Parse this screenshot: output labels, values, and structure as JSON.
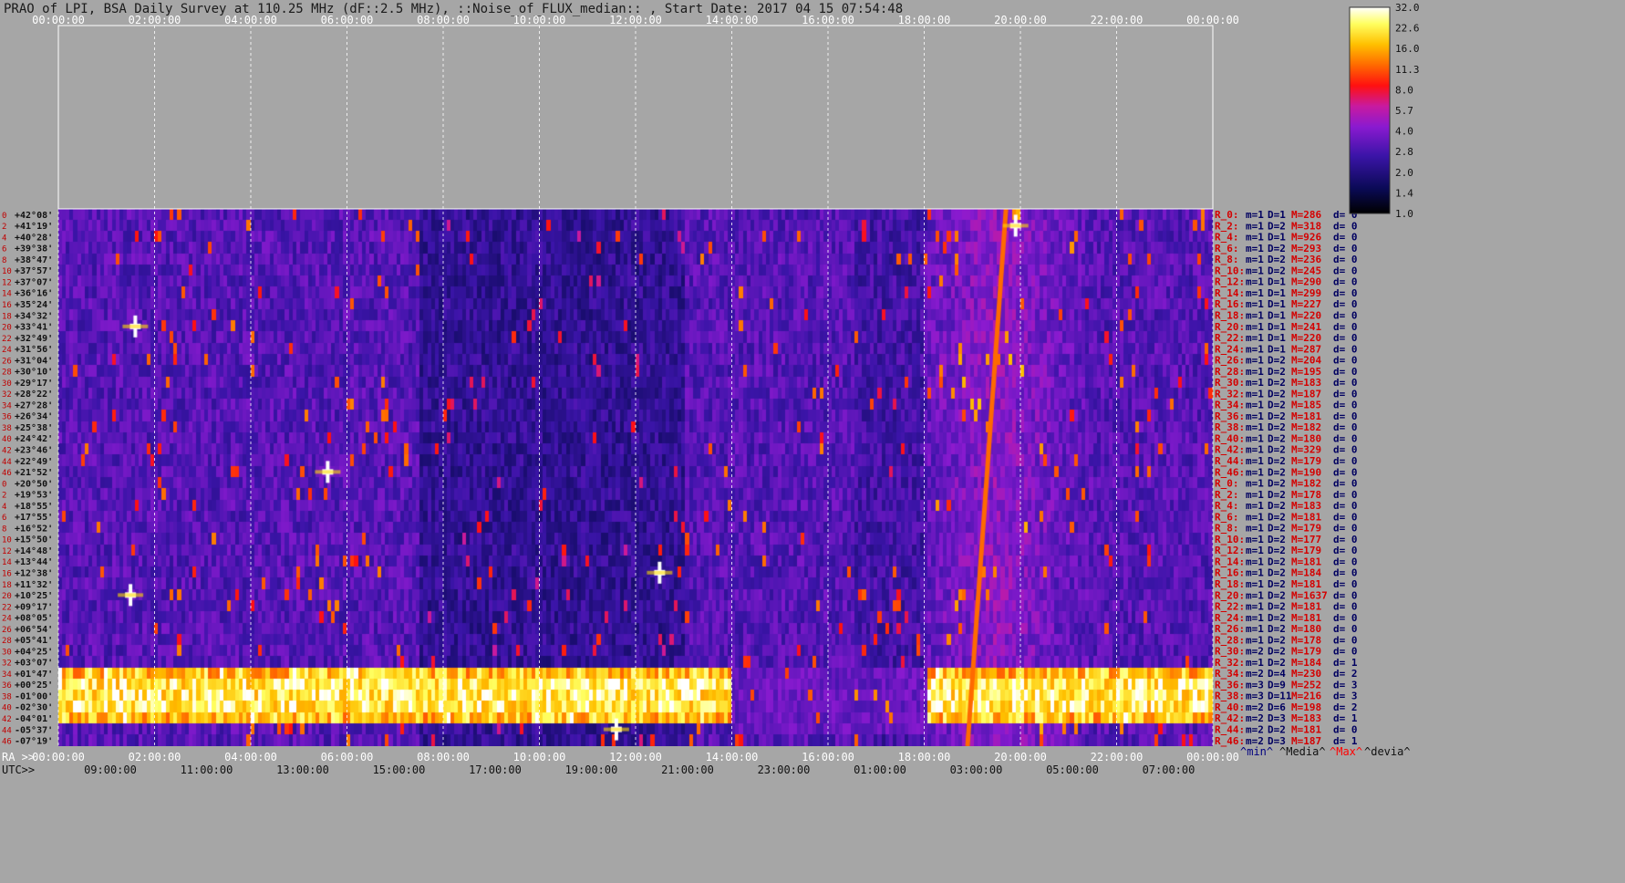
{
  "title": "PRAO of LPI, BSA Daily Survey at 110.25 MHz (dF::2.5 MHz), ::Noise_of_FLUX_median:: , Start Date: 2017 04 15 07:54:48",
  "colors": {
    "background": "#a6a6a6",
    "beam_label_red": "#d40000",
    "beam_value_navy": "#000060",
    "legend_min": "#000080",
    "legend_max": "#ff0000"
  },
  "chart_data": {
    "type": "heatmap",
    "top_time_axis": {
      "labels": [
        "00:00:00",
        "02:00:00",
        "04:00:00",
        "06:00:00",
        "08:00:00",
        "10:00:00",
        "12:00:00",
        "14:00:00",
        "16:00:00",
        "18:00:00",
        "20:00:00",
        "22:00:00",
        "00:00:00"
      ],
      "range_hours": [
        0,
        24
      ]
    },
    "bottom_ra_axis": {
      "prefix": "RA >>",
      "labels": [
        "00:00:00",
        "02:00:00",
        "04:00:00",
        "06:00:00",
        "08:00:00",
        "10:00:00",
        "12:00:00",
        "14:00:00",
        "16:00:00",
        "18:00:00",
        "20:00:00",
        "22:00:00",
        "00:00:00"
      ]
    },
    "bottom_utc_axis": {
      "prefix": "UTC>>",
      "labels": [
        "09:00:00",
        "11:00:00",
        "13:00:00",
        "15:00:00",
        "17:00:00",
        "19:00:00",
        "21:00:00",
        "23:00:00",
        "01:00:00",
        "03:00:00",
        "05:00:00",
        "07:00:00"
      ]
    },
    "colorbar": {
      "ticks": [
        "32.0",
        "22.6",
        "16.0",
        "11.3",
        "8.0",
        "5.7",
        "4.0",
        "2.8",
        "2.0",
        "1.4",
        "1.0"
      ],
      "scale": "log2",
      "range": [
        1.0,
        32.0
      ],
      "colormap": "black-blue-purple-red-orange-yellow-white"
    },
    "row_indices": [
      "0",
      "2",
      "4",
      "6",
      "8",
      "10",
      "12",
      "14",
      "16",
      "18",
      "20",
      "22",
      "24",
      "26",
      "28",
      "30",
      "32",
      "34",
      "36",
      "38",
      "40",
      "42",
      "44",
      "46",
      "0",
      "2",
      "4",
      "6",
      "8",
      "10",
      "12",
      "14",
      "16",
      "18",
      "20",
      "22",
      "24",
      "26",
      "28",
      "30",
      "32",
      "34",
      "36",
      "38",
      "40",
      "42",
      "44",
      "46"
    ],
    "declinations": [
      "+42°08'",
      "+41°19'",
      "+40°28'",
      "+39°38'",
      "+38°47'",
      "+37°57'",
      "+37°07'",
      "+36°16'",
      "+35°24'",
      "+34°32'",
      "+33°41'",
      "+32°49'",
      "+31°56'",
      "+31°04'",
      "+30°10'",
      "+29°17'",
      "+28°22'",
      "+27°28'",
      "+26°34'",
      "+25°38'",
      "+24°42'",
      "+23°46'",
      "+22°49'",
      "+21°52'",
      "+20°50'",
      "+19°53'",
      "+18°55'",
      "+17°55'",
      "+16°52'",
      "+15°50'",
      "+14°48'",
      "+13°44'",
      "+12°38'",
      "+11°32'",
      "+10°25'",
      "+09°17'",
      "+08°05'",
      "+06°54'",
      "+05°41'",
      "+04°25'",
      "+03°07'",
      "+01°47'",
      "+00°25'",
      "-01°00'",
      "-02°30'",
      "-04°01'",
      "-05°37'",
      "-07°19'"
    ],
    "beams": [
      {
        "beam": "R_0:",
        "m": "m=1",
        "D": "D=1",
        "M": "M=286",
        "d": "d= 0"
      },
      {
        "beam": "R_2:",
        "m": "m=1",
        "D": "D=2",
        "M": "M=318",
        "d": "d= 0"
      },
      {
        "beam": "R_4:",
        "m": "m=1",
        "D": "D=1",
        "M": "M=926",
        "d": "d= 0"
      },
      {
        "beam": "R_6:",
        "m": "m=1",
        "D": "D=2",
        "M": "M=293",
        "d": "d= 0"
      },
      {
        "beam": "R_8:",
        "m": "m=1",
        "D": "D=2",
        "M": "M=236",
        "d": "d= 0"
      },
      {
        "beam": "R_10:",
        "m": "m=1",
        "D": "D=2",
        "M": "M=245",
        "d": "d= 0"
      },
      {
        "beam": "R_12:",
        "m": "m=1",
        "D": "D=1",
        "M": "M=290",
        "d": "d= 0"
      },
      {
        "beam": "R_14:",
        "m": "m=1",
        "D": "D=1",
        "M": "M=299",
        "d": "d= 0"
      },
      {
        "beam": "R_16:",
        "m": "m=1",
        "D": "D=1",
        "M": "M=227",
        "d": "d= 0"
      },
      {
        "beam": "R_18:",
        "m": "m=1",
        "D": "D=1",
        "M": "M=220",
        "d": "d= 0"
      },
      {
        "beam": "R_20:",
        "m": "m=1",
        "D": "D=1",
        "M": "M=241",
        "d": "d= 0"
      },
      {
        "beam": "R_22:",
        "m": "m=1",
        "D": "D=1",
        "M": "M=220",
        "d": "d= 0"
      },
      {
        "beam": "R_24:",
        "m": "m=1",
        "D": "D=1",
        "M": "M=287",
        "d": "d= 0"
      },
      {
        "beam": "R_26:",
        "m": "m=1",
        "D": "D=2",
        "M": "M=204",
        "d": "d= 0"
      },
      {
        "beam": "R_28:",
        "m": "m=1",
        "D": "D=2",
        "M": "M=195",
        "d": "d= 0"
      },
      {
        "beam": "R_30:",
        "m": "m=1",
        "D": "D=2",
        "M": "M=183",
        "d": "d= 0"
      },
      {
        "beam": "R_32:",
        "m": "m=1",
        "D": "D=2",
        "M": "M=187",
        "d": "d= 0"
      },
      {
        "beam": "R_34:",
        "m": "m=1",
        "D": "D=2",
        "M": "M=185",
        "d": "d= 0"
      },
      {
        "beam": "R_36:",
        "m": "m=1",
        "D": "D=2",
        "M": "M=181",
        "d": "d= 0"
      },
      {
        "beam": "R_38:",
        "m": "m=1",
        "D": "D=2",
        "M": "M=182",
        "d": "d= 0"
      },
      {
        "beam": "R_40:",
        "m": "m=1",
        "D": "D=2",
        "M": "M=180",
        "d": "d= 0"
      },
      {
        "beam": "R_42:",
        "m": "m=1",
        "D": "D=2",
        "M": "M=329",
        "d": "d= 0"
      },
      {
        "beam": "R_44:",
        "m": "m=1",
        "D": "D=2",
        "M": "M=179",
        "d": "d= 0"
      },
      {
        "beam": "R_46:",
        "m": "m=1",
        "D": "D=2",
        "M": "M=190",
        "d": "d= 0"
      },
      {
        "beam": "R_0:",
        "m": "m=1",
        "D": "D=2",
        "M": "M=182",
        "d": "d= 0"
      },
      {
        "beam": "R_2:",
        "m": "m=1",
        "D": "D=2",
        "M": "M=178",
        "d": "d= 0"
      },
      {
        "beam": "R_4:",
        "m": "m=1",
        "D": "D=2",
        "M": "M=183",
        "d": "d= 0"
      },
      {
        "beam": "R_6:",
        "m": "m=1",
        "D": "D=2",
        "M": "M=181",
        "d": "d= 0"
      },
      {
        "beam": "R_8:",
        "m": "m=1",
        "D": "D=2",
        "M": "M=179",
        "d": "d= 0"
      },
      {
        "beam": "R_10:",
        "m": "m=1",
        "D": "D=2",
        "M": "M=177",
        "d": "d= 0"
      },
      {
        "beam": "R_12:",
        "m": "m=1",
        "D": "D=2",
        "M": "M=179",
        "d": "d= 0"
      },
      {
        "beam": "R_14:",
        "m": "m=1",
        "D": "D=2",
        "M": "M=181",
        "d": "d= 0"
      },
      {
        "beam": "R_16:",
        "m": "m=1",
        "D": "D=2",
        "M": "M=184",
        "d": "d= 0"
      },
      {
        "beam": "R_18:",
        "m": "m=1",
        "D": "D=2",
        "M": "M=181",
        "d": "d= 0"
      },
      {
        "beam": "R_20:",
        "m": "m=1",
        "D": "D=2",
        "M": "M=1637",
        "d": "d= 0"
      },
      {
        "beam": "R_22:",
        "m": "m=1",
        "D": "D=2",
        "M": "M=181",
        "d": "d= 0"
      },
      {
        "beam": "R_24:",
        "m": "m=1",
        "D": "D=2",
        "M": "M=181",
        "d": "d= 0"
      },
      {
        "beam": "R_26:",
        "m": "m=1",
        "D": "D=2",
        "M": "M=180",
        "d": "d= 0"
      },
      {
        "beam": "R_28:",
        "m": "m=1",
        "D": "D=2",
        "M": "M=178",
        "d": "d= 0"
      },
      {
        "beam": "R_30:",
        "m": "m=2",
        "D": "D=2",
        "M": "M=179",
        "d": "d= 0"
      },
      {
        "beam": "R_32:",
        "m": "m=1",
        "D": "D=2",
        "M": "M=184",
        "d": "d= 1"
      },
      {
        "beam": "R_34:",
        "m": "m=2",
        "D": "D=4",
        "M": "M=230",
        "d": "d= 2"
      },
      {
        "beam": "R_36:",
        "m": "m=3",
        "D": "D=9",
        "M": "M=252",
        "d": "d= 3"
      },
      {
        "beam": "R_38:",
        "m": "m=3",
        "D": "D=11",
        "M": "M=216",
        "d": "d= 3"
      },
      {
        "beam": "R_40:",
        "m": "m=2",
        "D": "D=6",
        "M": "M=198",
        "d": "d= 2"
      },
      {
        "beam": "R_42:",
        "m": "m=2",
        "D": "D=3",
        "M": "M=183",
        "d": "d= 1"
      },
      {
        "beam": "R_44:",
        "m": "m=2",
        "D": "D=2",
        "M": "M=181",
        "d": "d= 0"
      },
      {
        "beam": "R_46:",
        "m": "m=2",
        "D": "D=3",
        "M": "M=187",
        "d": "d= 1"
      }
    ],
    "legend_keys": [
      "^min^",
      "^Media^",
      "^Max^",
      "^devia^"
    ]
  }
}
